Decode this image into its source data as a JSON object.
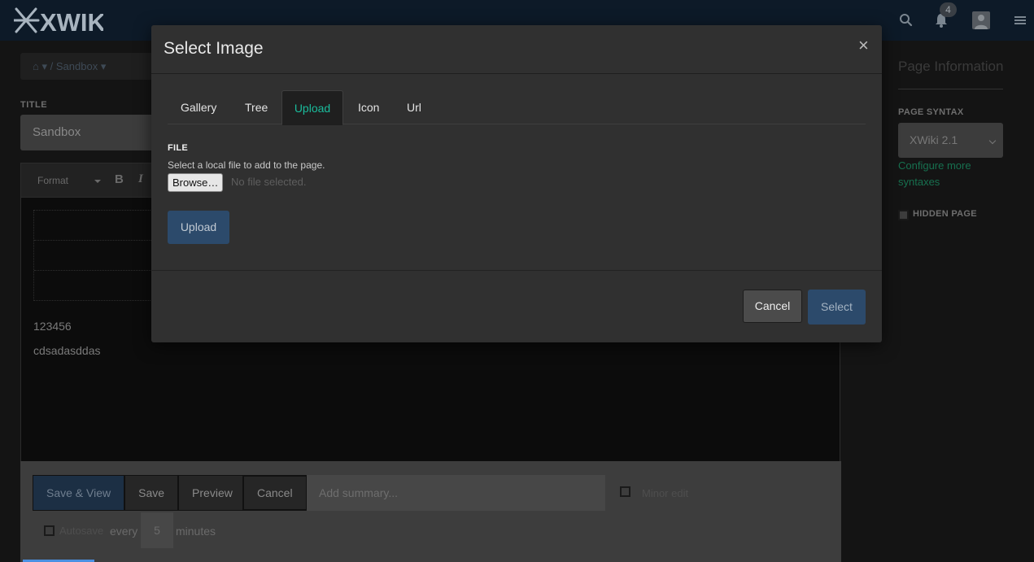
{
  "header": {
    "logo_text": "XWIKI",
    "notifications_count": "4",
    "icons": [
      "search-icon",
      "bell-icon",
      "avatar-icon",
      "menu-icon"
    ]
  },
  "breadcrumb": {
    "home_icon": "home-icon",
    "separator": "/",
    "current": "Sandbox"
  },
  "edit_form": {
    "title_label": "TITLE",
    "title_value": "Sandbox",
    "toolbar": {
      "format_label": "Format",
      "bold_label": "B",
      "italic_label": "I"
    },
    "content_lines": [
      "123456",
      "cdsadasddas"
    ]
  },
  "actions": {
    "save_view_label": "Save & View",
    "save_label": "Save",
    "preview_label": "Preview",
    "cancel_label": "Cancel",
    "summary_placeholder": "Add summary...",
    "minor_edit_label": "Minor edit",
    "autosave_label": "Autosave",
    "every_label": "every",
    "interval_value": "5",
    "minutes_label": "minutes"
  },
  "sidebar": {
    "title": "Page Information",
    "syntax_label": "PAGE SYNTAX",
    "syntax_value": "XWiki 2.1",
    "configure_link": "Configure more syntaxes",
    "hidden_page_label": "HIDDEN PAGE"
  },
  "modal": {
    "title": "Select Image",
    "close_symbol": "×",
    "tabs": [
      {
        "label": "Gallery",
        "active": false
      },
      {
        "label": "Tree",
        "active": false
      },
      {
        "label": "Upload",
        "active": true
      },
      {
        "label": "Icon",
        "active": false
      },
      {
        "label": "Url",
        "active": false
      }
    ],
    "file_label": "FILE",
    "file_help": "Select a local file to add to the page.",
    "browse_label": "Browse…",
    "no_file_text": "No file selected.",
    "upload_label": "Upload",
    "cancel_label": "Cancel",
    "select_label": "Select"
  },
  "colors": {
    "accent_green": "#1abc9c",
    "primary_blue": "#2c4a6b",
    "topbar_bg": "#0d1a28"
  }
}
